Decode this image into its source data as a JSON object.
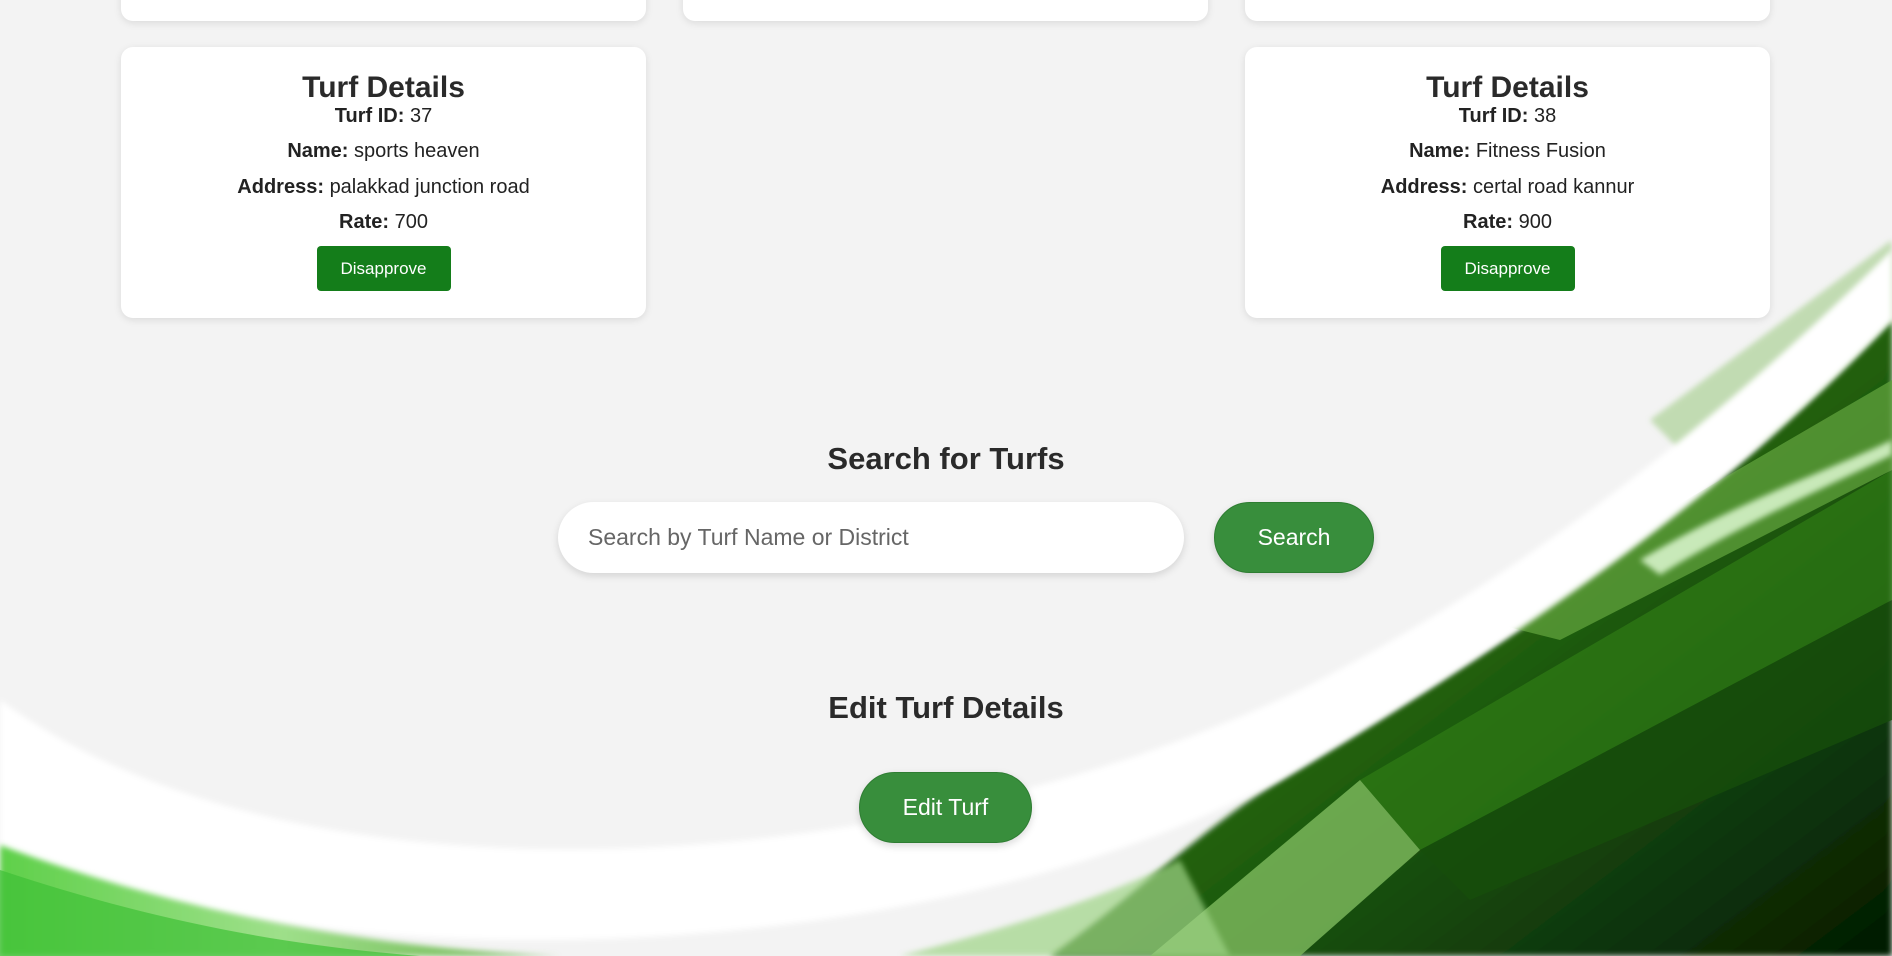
{
  "cards": [
    {
      "title": "Turf Details",
      "id_label": "Turf ID:",
      "id_value": "37",
      "name_label": "Name:",
      "name_value": "sports heaven",
      "address_label": "Address:",
      "address_value": "palakkad junction road",
      "rate_label": "Rate:",
      "rate_value": "700",
      "button_label": "Disapprove"
    },
    {
      "title": "Turf Details",
      "id_label": "Turf ID:",
      "id_value": "38",
      "name_label": "Name:",
      "name_value": "Fitness Fusion",
      "address_label": "Address:",
      "address_value": "certal road kannur",
      "rate_label": "Rate:",
      "rate_value": "900",
      "button_label": "Disapprove"
    }
  ],
  "search": {
    "title": "Search for Turfs",
    "placeholder": "Search by Turf Name or District",
    "button_label": "Search"
  },
  "edit": {
    "title": "Edit Turf Details",
    "button_label": "Edit Turf"
  },
  "colors": {
    "page_background": "#f3f3f3",
    "disapprove_button": "#147d1a",
    "pill_button": "#388e3c"
  }
}
